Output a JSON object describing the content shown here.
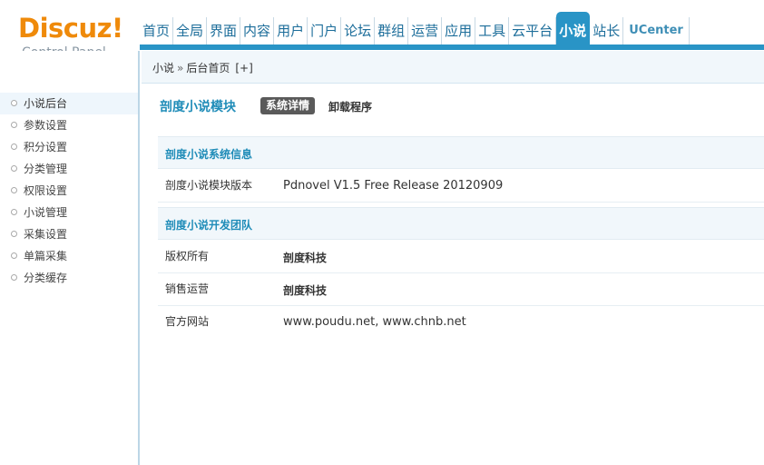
{
  "logo": {
    "brand": "Discuz!",
    "subtitle": "Control Panel"
  },
  "nav": [
    {
      "label": "首页"
    },
    {
      "label": "全局"
    },
    {
      "label": "界面"
    },
    {
      "label": "内容"
    },
    {
      "label": "用户"
    },
    {
      "label": "门户"
    },
    {
      "label": "论坛"
    },
    {
      "label": "群组"
    },
    {
      "label": "运营"
    },
    {
      "label": "应用"
    },
    {
      "label": "工具"
    },
    {
      "label": "云平台"
    },
    {
      "label": "小说",
      "active": true
    },
    {
      "label": "站长"
    },
    {
      "label": "UCenter"
    }
  ],
  "breadcrumb": {
    "root": "小说",
    "separator": "»",
    "current": "后台首页",
    "add": "[+]"
  },
  "sidebar": {
    "items": [
      {
        "label": "小说后台",
        "active": true
      },
      {
        "label": "参数设置"
      },
      {
        "label": "积分设置"
      },
      {
        "label": "分类管理"
      },
      {
        "label": "权限设置"
      },
      {
        "label": "小说管理"
      },
      {
        "label": "采集设置"
      },
      {
        "label": "单篇采集"
      },
      {
        "label": "分类缓存"
      }
    ]
  },
  "main": {
    "title": "剖度小说模块",
    "tabs": {
      "detail": "系统详情",
      "uninstall": "卸载程序"
    },
    "system_info": {
      "heading": "剖度小说系统信息",
      "version_label": "剖度小说模块版本",
      "version_value": "Pdnovel V1.5 Free Release 20120909"
    },
    "team": {
      "heading": "剖度小说开发团队",
      "copyright_label": "版权所有",
      "copyright_value": "剖度科技",
      "operation_label": "销售运营",
      "operation_value": "剖度科技",
      "website_label": "官方网站",
      "website_value": "www.poudu.net, www.chnb.net"
    }
  },
  "colors": {
    "accent": "#2994c6",
    "logo": "#ef8a0a",
    "heading": "#1f8cb8"
  }
}
